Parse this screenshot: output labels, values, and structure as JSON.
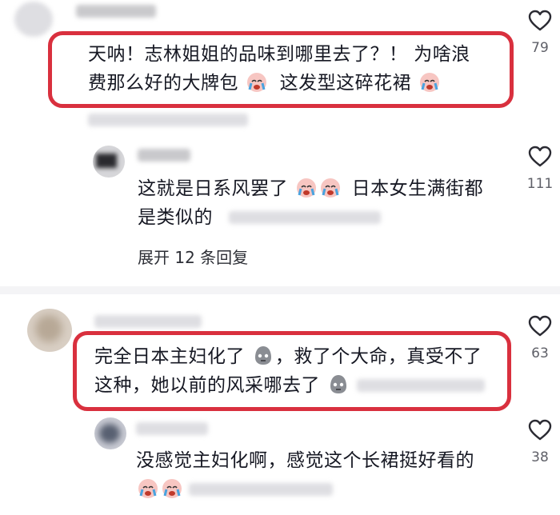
{
  "comments": [
    {
      "text_a": "天呐！志林姐姐的品味到哪里去了？！ 为啥浪",
      "text_b1": "费那么好的大牌包",
      "text_b2": "这发型这碎花裙",
      "likes": "79"
    },
    {
      "text_a": "这就是日系风罢了",
      "text_a2": "日本女生满街都",
      "text_b": "是类似的",
      "likes": "111",
      "expand": "展开 12 条回复"
    },
    {
      "text_a1": "完全日本主妇化了",
      "text_a2": "，救了个大命，真受不了",
      "text_b1": "这种，她以前的风采哪去了",
      "likes": "63"
    },
    {
      "text_a": "没感觉主妇化啊，感觉这个长裙挺好看的",
      "likes": "38"
    }
  ],
  "icons": {
    "like": "heart-outline-icon",
    "crying_emoji": "crying-face-emoji",
    "speechless_emoji": "gray-blob-emoji"
  },
  "colors": {
    "highlight_border": "#d9303e",
    "text": "#161823",
    "count": "#5f6068"
  }
}
